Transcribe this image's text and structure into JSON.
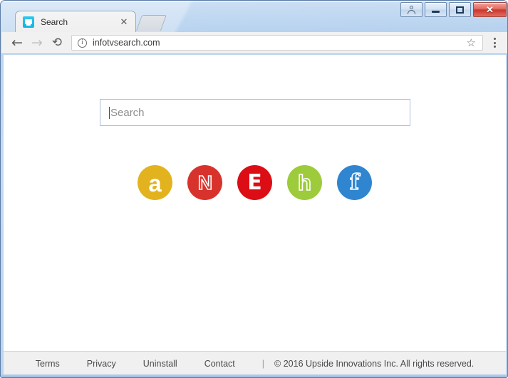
{
  "window": {
    "controls": {
      "profile_label": "profile-user",
      "minimize_label": "–",
      "maximize_label": "□",
      "close_label": "✕"
    }
  },
  "browser": {
    "tab": {
      "title": "Search",
      "favicon": "tv-screen-icon",
      "close_label": "✕"
    },
    "newtab_label": "",
    "nav": {
      "back": "←",
      "forward": "→",
      "reload": "⟳"
    },
    "omnibox": {
      "info_icon_label": "i",
      "url": "infotvsearch.com",
      "star_icon_label": "☆"
    },
    "menu_icon_label": "kebab-menu"
  },
  "page": {
    "search": {
      "placeholder": "Search",
      "value": ""
    },
    "shortcuts": [
      {
        "name": "amazon",
        "letter": "a",
        "color": "#e2b31e"
      },
      {
        "name": "netflix",
        "letter": "N",
        "color": "#d8322c"
      },
      {
        "name": "espn",
        "letter": "E",
        "color": "#dc0d15"
      },
      {
        "name": "hulu",
        "letter": "h",
        "color": "#9dcb3b"
      },
      {
        "name": "facebook",
        "letter": "f",
        "color": "#2f85d0"
      }
    ]
  },
  "footer": {
    "links": [
      "Terms",
      "Privacy",
      "Uninstall",
      "Contact"
    ],
    "separator": "|",
    "copyright": "© 2016 Upside Innovations Inc. All rights reserved."
  }
}
